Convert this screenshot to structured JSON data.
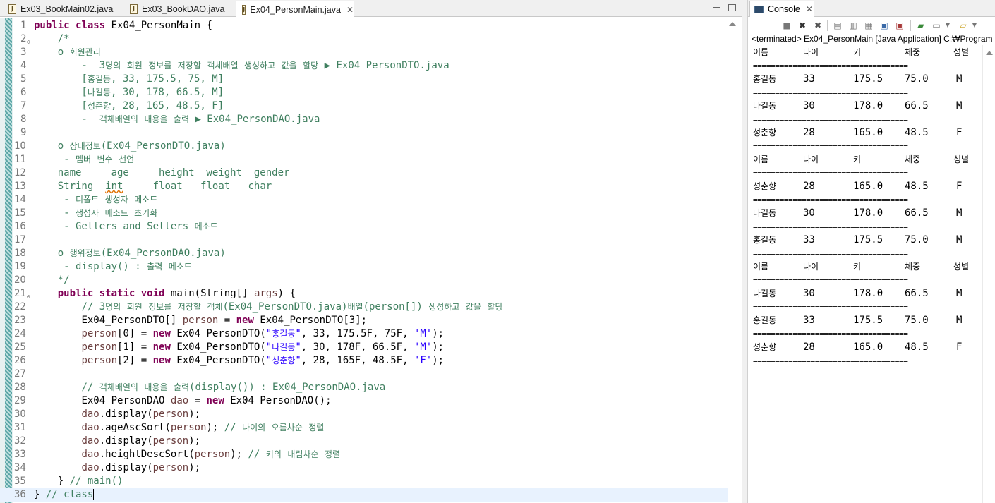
{
  "editor": {
    "tabs": [
      {
        "label": "Ex03_BookMain02.java",
        "active": false
      },
      {
        "label": "Ex03_BookDAO.java",
        "active": false
      },
      {
        "label": "Ex04_PersonMain.java",
        "active": true
      }
    ],
    "current_line": 36,
    "lines": [
      {
        "n": "1",
        "t": "public class Ex04_PersonMain {"
      },
      {
        "n": "2",
        "t": "    /*"
      },
      {
        "n": "3",
        "t": "    o 회원관리"
      },
      {
        "n": "4",
        "t": "        -  3명의 회원 정보를 저장할 객체배열 생성하고 값을 할당 ▶ Ex04_PersonDTO.java"
      },
      {
        "n": "5",
        "t": "        [홍길동, 33, 175.5, 75, M]"
      },
      {
        "n": "6",
        "t": "        [나길동, 30, 178, 66.5, M]"
      },
      {
        "n": "7",
        "t": "        [성춘향, 28, 165, 48.5, F]"
      },
      {
        "n": "8",
        "t": "        -  객체배열의 내용을 출력 ▶ Ex04_PersonDAO.java"
      },
      {
        "n": "9",
        "t": ""
      },
      {
        "n": "10",
        "t": "    o 상태정보(Ex04_PersonDTO.java)"
      },
      {
        "n": "11",
        "t": "     - 멤버 변수 선언"
      },
      {
        "n": "12",
        "t": "    name     age     height  weight  gender"
      },
      {
        "n": "13",
        "t": "    String  int     float   float   char"
      },
      {
        "n": "14",
        "t": "     - 디폴트 생성자 메소드"
      },
      {
        "n": "15",
        "t": "     - 생성자 메소드 초기화"
      },
      {
        "n": "16",
        "t": "     - Getters and Setters 메소드"
      },
      {
        "n": "17",
        "t": ""
      },
      {
        "n": "18",
        "t": "    o 행위정보(Ex04_PersonDAO.java)"
      },
      {
        "n": "19",
        "t": "     - display() : 출력 메소드"
      },
      {
        "n": "20",
        "t": "    */"
      },
      {
        "n": "21",
        "t": "    public static void main(String[] args) {"
      },
      {
        "n": "22",
        "t": "        // 3명의 회원 정보를 저장할 객체(Ex04_PersonDTO.java)배열(person[]) 생성하고 값을 할당"
      },
      {
        "n": "23",
        "t": "        Ex04_PersonDTO[] person = new Ex04_PersonDTO[3];"
      },
      {
        "n": "24",
        "t": "        person[0] = new Ex04_PersonDTO(\"홍길동\", 33, 175.5F, 75F, 'M');"
      },
      {
        "n": "25",
        "t": "        person[1] = new Ex04_PersonDTO(\"나길동\", 30, 178F, 66.5F, 'M');"
      },
      {
        "n": "26",
        "t": "        person[2] = new Ex04_PersonDTO(\"성춘향\", 28, 165F, 48.5F, 'F');"
      },
      {
        "n": "27",
        "t": ""
      },
      {
        "n": "28",
        "t": "        // 객체배열의 내용을 출력(display()) : Ex04_PersonDAO.java"
      },
      {
        "n": "29",
        "t": "        Ex04_PersonDAO dao = new Ex04_PersonDAO();"
      },
      {
        "n": "30",
        "t": "        dao.display(person);"
      },
      {
        "n": "31",
        "t": "        dao.ageAscSort(person); // 나이의 오름차순 정렬"
      },
      {
        "n": "32",
        "t": "        dao.display(person);"
      },
      {
        "n": "33",
        "t": "        dao.heightDescSort(person); // 키의 내림차순 정렬"
      },
      {
        "n": "34",
        "t": "        dao.display(person);"
      },
      {
        "n": "35",
        "t": "    } // main()"
      },
      {
        "n": "36",
        "t": "} // class"
      }
    ]
  },
  "console": {
    "tab_label": "Console",
    "status": "<terminated> Ex04_PersonMain [Java Application] C:₩Program",
    "separator": "===================================",
    "header": [
      "이름",
      "나이",
      "키",
      "체중",
      "성별"
    ],
    "blocks": [
      [
        [
          "홍길동",
          "33",
          "175.5",
          "75.0",
          "M"
        ],
        [
          "나길동",
          "30",
          "178.0",
          "66.5",
          "M"
        ],
        [
          "성춘향",
          "28",
          "165.0",
          "48.5",
          "F"
        ]
      ],
      [
        [
          "성춘향",
          "28",
          "165.0",
          "48.5",
          "F"
        ],
        [
          "나길동",
          "30",
          "178.0",
          "66.5",
          "M"
        ],
        [
          "홍길동",
          "33",
          "175.5",
          "75.0",
          "M"
        ]
      ],
      [
        [
          "나길동",
          "30",
          "178.0",
          "66.5",
          "M"
        ],
        [
          "홍길동",
          "33",
          "175.5",
          "75.0",
          "M"
        ],
        [
          "성춘향",
          "28",
          "165.0",
          "48.5",
          "F"
        ]
      ]
    ]
  }
}
